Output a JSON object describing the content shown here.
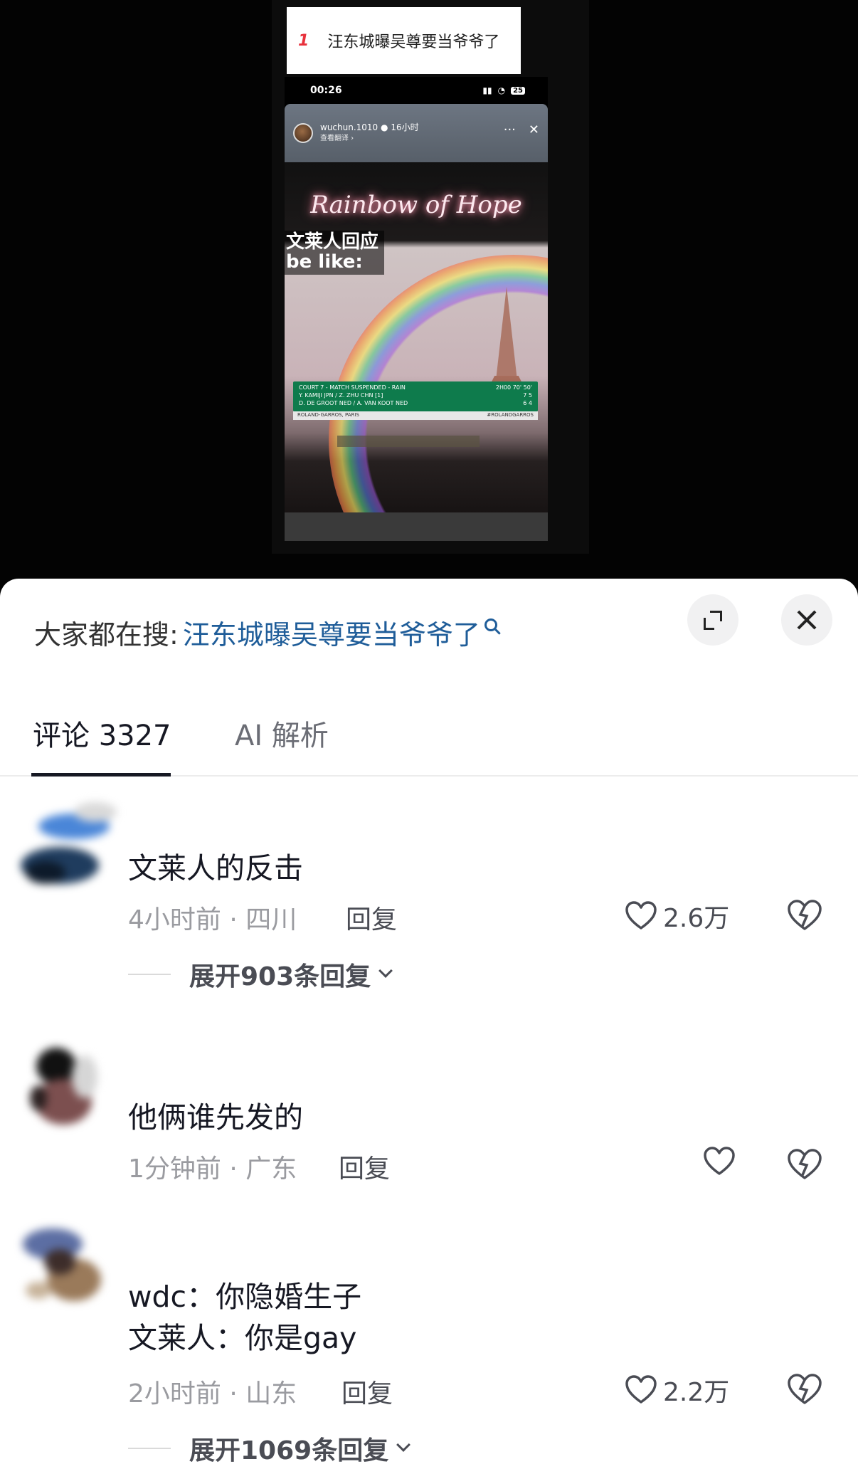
{
  "hot_banner": {
    "rank": "1",
    "title": "汪东城曝吴尊要当爷爷了"
  },
  "phone_status": {
    "time": "00:26",
    "battery": "25"
  },
  "story": {
    "username": "wuchun.1010",
    "time_ago": "16小时",
    "translate": "查看翻译 ›",
    "more": "···",
    "close": "✕",
    "neon_text": "Rainbow of Hope",
    "caption_line1": "文莱人回应",
    "caption_line2": "be like:",
    "score_header": "COURT 7 - MATCH SUSPENDED - RAIN",
    "score_time": "2H00   70'   50'",
    "score_row1": "Y. KAMIJI JPN / Z. ZHU CHN [1]",
    "score_row1_sets": "7   5",
    "score_row2": "D. DE GROOT NED / A. VAN KOOT NED",
    "score_row2_sets": "6   4",
    "score_foot_left": "ROLAND-GARROS, PARIS",
    "score_foot_right": "#ROLANDGARROS"
  },
  "sheet": {
    "search_prefix": "大家都在搜:",
    "search_term": "汪东城曝吴尊要当爷爷了",
    "tabs": [
      {
        "label": "评论 3327"
      },
      {
        "label": "AI 解析"
      }
    ]
  },
  "comments": [
    {
      "text": "文莱人的反击",
      "meta": "4小时前 · 四川",
      "reply": "回复",
      "likes": "2.6万",
      "expand": "展开903条回复"
    },
    {
      "text": "他俩谁先发的",
      "meta": "1分钟前 · 广东",
      "reply": "回复",
      "likes": ""
    },
    {
      "text": "wdc：你隐婚生子\n文莱人：你是gay",
      "meta": "2小时前 · 山东",
      "reply": "回复",
      "likes": "2.2万",
      "expand": "展开1069条回复"
    }
  ],
  "colors": {
    "link": "#1f5d99",
    "rank": "#e8313c",
    "score_green": "#0e7b4c"
  }
}
